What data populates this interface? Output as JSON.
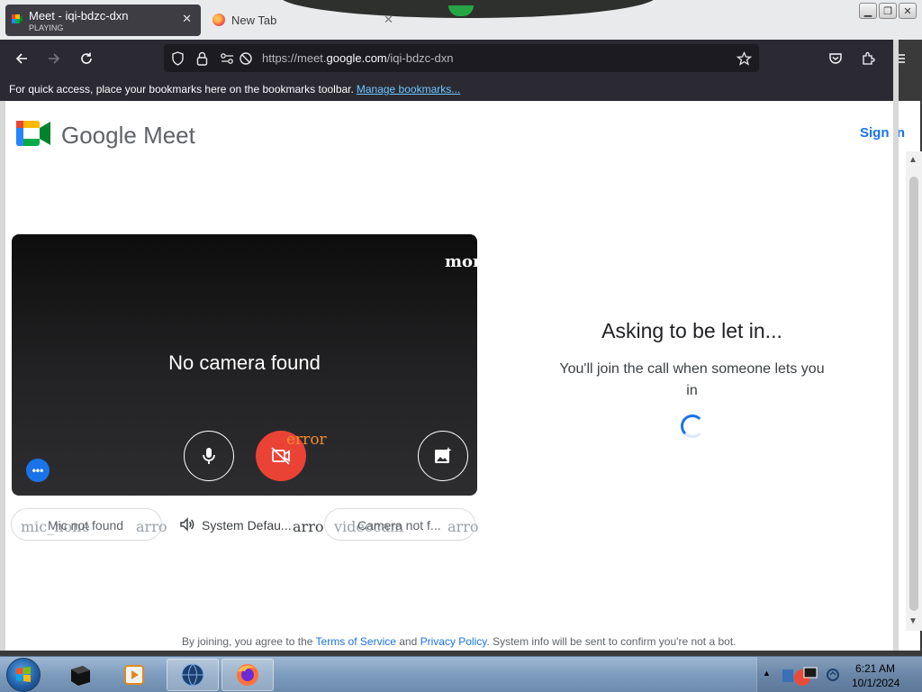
{
  "browser": {
    "tabs": [
      {
        "title": "Meet - iqi-bdzc-dxn",
        "subtitle": "PLAYING",
        "close": "✕"
      },
      {
        "title": "New Tab",
        "close": "✕"
      }
    ],
    "url_prefix": "https://meet.",
    "url_host": "google.com",
    "url_path": "/iqi-bdzc-dxn",
    "bookmarks_hint": "For quick access, place your bookmarks here on the bookmarks toolbar.",
    "manage_bookmarks": "Manage bookmarks..."
  },
  "meet": {
    "brand": "Google Meet",
    "signin": "Sign in",
    "preview": {
      "more_label": "mor",
      "no_camera": "No camera found",
      "error_label": "error"
    },
    "devices": {
      "mic_icon_text": "mic_none",
      "mic_label": "Mic not found",
      "mic_arrow": "arro",
      "speaker_label": "System Defau...",
      "speaker_arrow": "arro",
      "video_icon_text": "videocam",
      "camera_label": "Camera not f...",
      "camera_arrow": "arro"
    },
    "status_title": "Asking to be let in...",
    "status_note": "You'll join the call when someone lets you in",
    "footer": {
      "prefix": "By joining, you agree to the ",
      "terms": "Terms of Service",
      "mid": " and ",
      "privacy": "Privacy Policy",
      "suffix": ". System info will be sent to confirm you're not a bot."
    }
  },
  "taskbar": {
    "time": "6:21 AM",
    "date": "10/1/2024"
  },
  "colors": {
    "meet_blue": "#1a73e8",
    "cam_off_red": "#ea4335",
    "browser_dark": "#2b2a33"
  }
}
